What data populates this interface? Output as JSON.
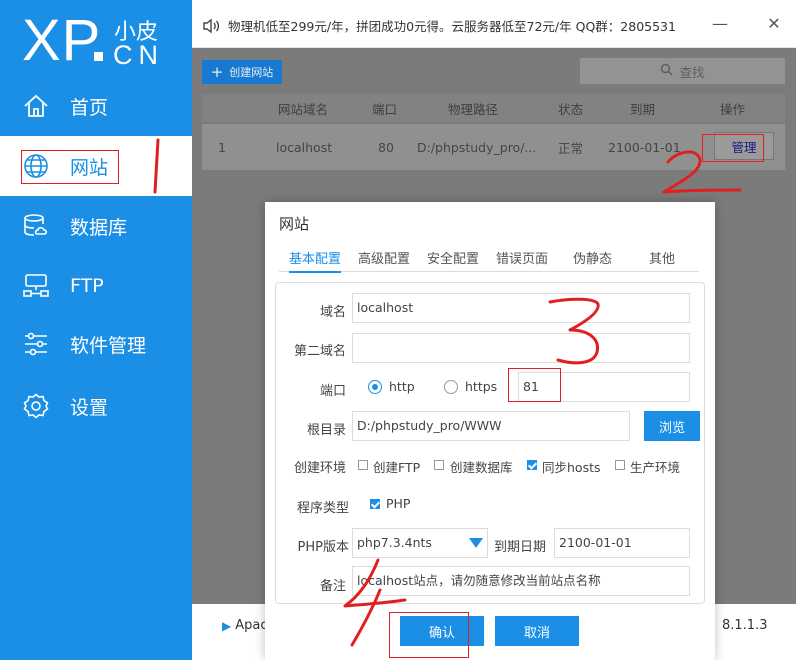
{
  "logo": {
    "mark": "XP",
    "cn_top": "小皮",
    "cn_bottom": "CN"
  },
  "sidebar": {
    "items": [
      {
        "label": "首页",
        "icon": "home-icon"
      },
      {
        "label": "网站",
        "icon": "globe-icon",
        "active": true
      },
      {
        "label": "数据库",
        "icon": "database-icon"
      },
      {
        "label": "FTP",
        "icon": "ftp-icon"
      },
      {
        "label": "软件管理",
        "icon": "sliders-icon"
      },
      {
        "label": "设置",
        "icon": "gear-icon"
      }
    ]
  },
  "topbar": {
    "notice": "物理机低至299元/年，拼团成功0元得。云服务器低至72元/年 QQ群：2805531",
    "minimize": "—",
    "close": "✕"
  },
  "main": {
    "create_button": "创建网站",
    "search_label": "查找",
    "columns": [
      "网站域名",
      "端口",
      "物理路径",
      "状态",
      "到期",
      "操作"
    ],
    "rows": [
      {
        "index": "1",
        "domain": "localhost",
        "port": "80",
        "path": "D:/phpstudy_pro/...",
        "status": "正常",
        "expire": "2100-01-01",
        "action": "管理"
      }
    ],
    "footer_left": "Apac",
    "footer_right": "8.1.1.3"
  },
  "dialog": {
    "title": "网站",
    "tabs": [
      "基本配置",
      "高级配置",
      "安全配置",
      "错误页面",
      "伪静态",
      "其他"
    ],
    "domain_label": "域名",
    "domain_value": "localhost",
    "second_domain_label": "第二域名",
    "second_domain_value": "",
    "port_label": "端口",
    "http_label": "http",
    "https_label": "https",
    "port_value": "81",
    "root_label": "根目录",
    "root_value": "D:/phpstudy_pro/WWW",
    "browse": "浏览",
    "env_label": "创建环境",
    "env_options": [
      {
        "label": "创建FTP",
        "checked": false
      },
      {
        "label": "创建数据库",
        "checked": false
      },
      {
        "label": "同步hosts",
        "checked": true
      },
      {
        "label": "生产环境",
        "checked": false
      }
    ],
    "program_label": "程序类型",
    "program_php": "PHP",
    "php_version_label": "PHP版本",
    "php_version_value": "php7.3.4nts",
    "expire_label": "到期日期",
    "expire_value": "2100-01-01",
    "note_label": "备注",
    "note_value": "localhost站点，请勿随意修改当前站点名称",
    "confirm": "确认",
    "cancel": "取消"
  },
  "colors": {
    "accent": "#1b8fe6",
    "annotation": "#e02020"
  }
}
